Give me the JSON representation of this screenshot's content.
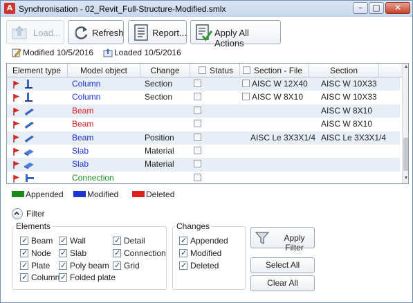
{
  "window": {
    "title": "Synchronisation - 02_Revit_Full-Structure-Modified.smlx"
  },
  "toolbar": {
    "load_label": "Load...",
    "refresh_label": "Refresh",
    "report_label": "Report...",
    "apply_all_label": "Apply All Actions"
  },
  "info": {
    "modified": "Modified 10/5/2016",
    "loaded": "Loaded 10/5/2016"
  },
  "table": {
    "headers": {
      "element_type": "Element type",
      "model_object": "Model object",
      "change": "Change",
      "status": "Status",
      "section_file": "Section - File",
      "section": "Section"
    },
    "rows": [
      {
        "icon": "column-icon",
        "object": "Column",
        "state": "modified",
        "change": "Section",
        "section_file": "AISC W 12X40",
        "section_file_checkbox": true,
        "section": "AISC W 10X33"
      },
      {
        "icon": "column-icon",
        "object": "Column",
        "state": "modified",
        "change": "Section",
        "section_file": "AISC W 8X10",
        "section_file_checkbox": true,
        "section": "AISC W 10X33"
      },
      {
        "icon": "beam-icon",
        "object": "Beam",
        "state": "deleted",
        "change": "",
        "section_file": "",
        "section_file_checkbox": false,
        "section": "AISC W 8X10"
      },
      {
        "icon": "beam-icon",
        "object": "Beam",
        "state": "deleted",
        "change": "",
        "section_file": "",
        "section_file_checkbox": false,
        "section": "AISC W 8X10"
      },
      {
        "icon": "beam-icon",
        "object": "Beam",
        "state": "modified",
        "change": "Position",
        "section_file": "AISC Le 3X3X1/4",
        "section_file_checkbox": false,
        "section": "AISC Le 3X3X1/4"
      },
      {
        "icon": "slab-icon",
        "object": "Slab",
        "state": "modified",
        "change": "Material",
        "section_file": "",
        "section_file_checkbox": false,
        "section": ""
      },
      {
        "icon": "slab-icon",
        "object": "Slab",
        "state": "modified",
        "change": "Material",
        "section_file": "",
        "section_file_checkbox": false,
        "section": ""
      },
      {
        "icon": "connection-icon",
        "object": "Connection",
        "state": "appended",
        "change": "",
        "section_file": "",
        "section_file_checkbox": false,
        "section": ""
      }
    ]
  },
  "legend": {
    "appended": "Appended",
    "modified": "Modified",
    "deleted": "Deleted"
  },
  "colors": {
    "appended": "#1b8a1b",
    "modified": "#1d33d6",
    "deleted": "#e01f1f"
  },
  "filter": {
    "label": "Filter",
    "elements_title": "Elements",
    "elements": {
      "beam": "Beam",
      "node": "Node",
      "plate": "Plate",
      "column": "Column",
      "wall": "Wall",
      "slab": "Slab",
      "poly_beam": "Poly beam",
      "folded_plate": "Folded plate",
      "detail": "Detail",
      "connection": "Connection",
      "grid": "Grid"
    },
    "changes_title": "Changes",
    "changes": {
      "appended": "Appended",
      "modified": "Modified",
      "deleted": "Deleted"
    },
    "apply_filter_label": "Apply Filter",
    "select_all_label": "Select All",
    "clear_all_label": "Clear All"
  }
}
